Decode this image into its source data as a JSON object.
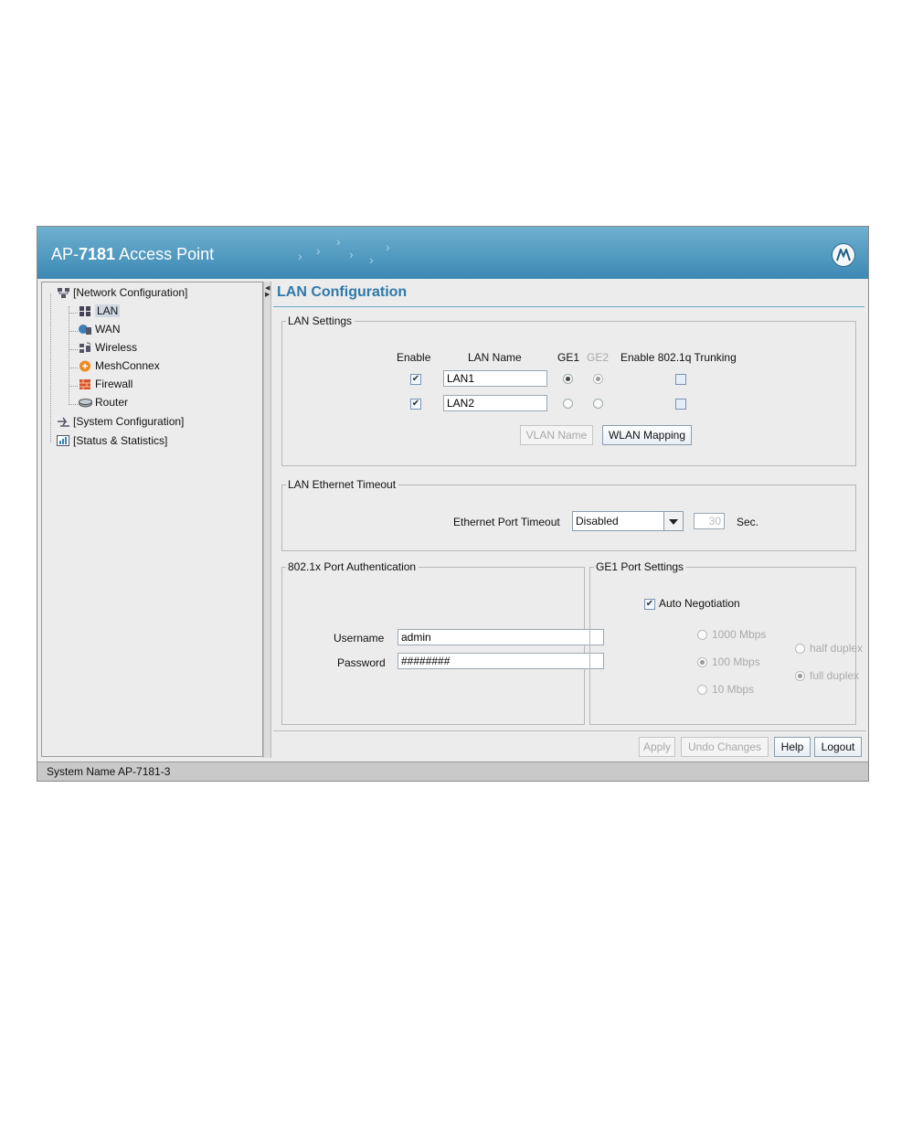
{
  "app": {
    "title_prefix": "AP-",
    "title_model": "7181",
    "title_suffix": " Access Point",
    "logo": "motorola-logo",
    "accent": "#3c89b4"
  },
  "tree": {
    "items": [
      {
        "label": "[Network Configuration]",
        "icon": "network-config-icon"
      },
      {
        "label": "LAN",
        "icon": "lan-icon",
        "selected": true
      },
      {
        "label": "WAN",
        "icon": "wan-icon"
      },
      {
        "label": "Wireless",
        "icon": "wireless-icon"
      },
      {
        "label": "MeshConnex",
        "icon": "meshconnex-icon"
      },
      {
        "label": "Firewall",
        "icon": "firewall-icon"
      },
      {
        "label": "Router",
        "icon": "router-icon"
      },
      {
        "label": "[System Configuration]",
        "icon": "system-config-icon"
      },
      {
        "label": "[Status & Statistics]",
        "icon": "statistics-icon"
      }
    ]
  },
  "main": {
    "title": "LAN Configuration",
    "lan_settings": {
      "legend": "LAN Settings",
      "headers": {
        "enable": "Enable",
        "lan_name": "LAN Name",
        "ge1": "GE1",
        "ge2": "GE2",
        "trunking": "Enable 802.1q Trunking"
      },
      "rows": [
        {
          "enabled": true,
          "name": "LAN1",
          "ge1": true,
          "ge2": true,
          "trunking": false
        },
        {
          "enabled": true,
          "name": "LAN2",
          "ge1": false,
          "ge2": false,
          "trunking": false
        }
      ],
      "vlan_name_button": "VLAN Name",
      "wlan_mapping_button": "WLAN Mapping"
    },
    "ethernet_timeout": {
      "legend": "LAN Ethernet Timeout",
      "label": "Ethernet Port Timeout",
      "selected": "Disabled",
      "seconds_value": "30",
      "unit": "Sec."
    },
    "auth": {
      "legend": "802.1x Port Authentication",
      "username_label": "Username",
      "username_value": "admin",
      "password_label": "Password",
      "password_value": "########"
    },
    "ge1_port": {
      "legend": "GE1 Port Settings",
      "auto_negotiation_label": "Auto Negotiation",
      "auto_negotiation": true,
      "speed_1000": "1000 Mbps",
      "speed_100": "100 Mbps",
      "speed_10": "10 Mbps",
      "selected_speed": "100 Mbps",
      "half_duplex": "half duplex",
      "full_duplex": "full duplex",
      "selected_duplex": "full duplex"
    },
    "buttons": {
      "apply": "Apply",
      "undo": "Undo Changes",
      "help": "Help",
      "logout": "Logout"
    }
  },
  "status": {
    "text": "System Name AP-7181-3"
  }
}
